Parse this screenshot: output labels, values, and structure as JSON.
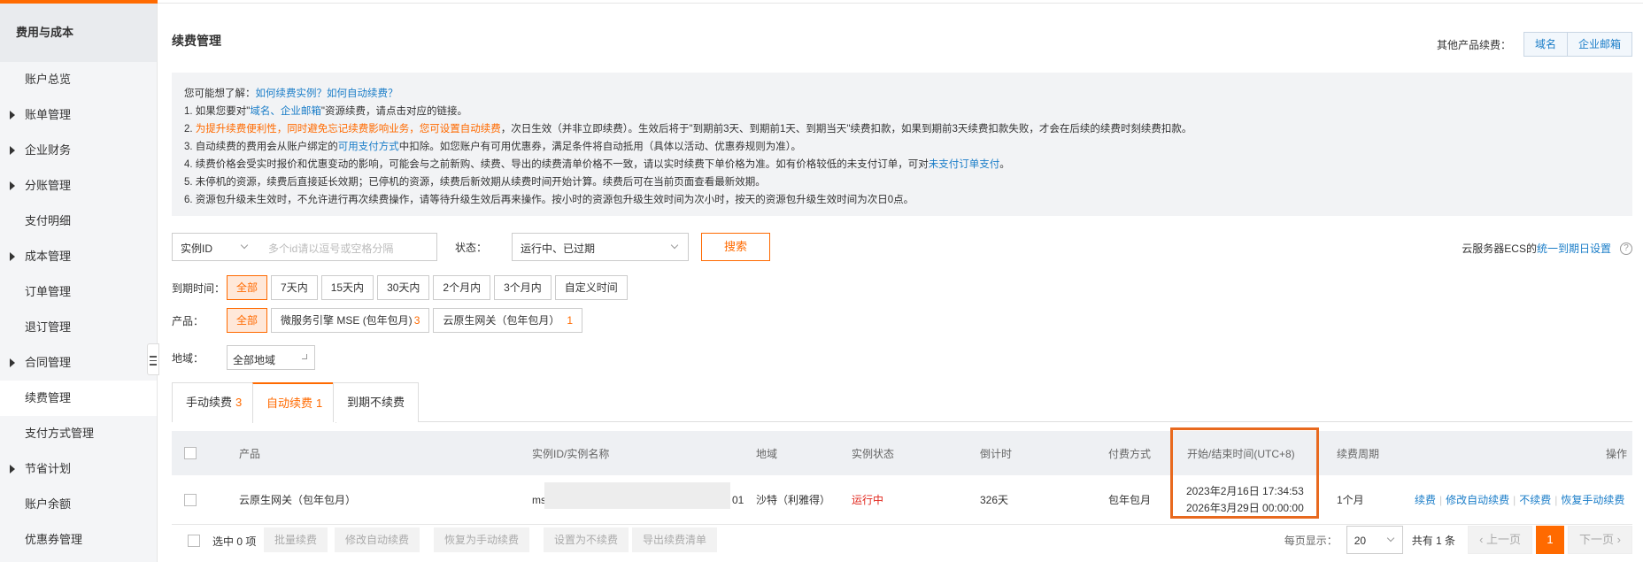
{
  "sidebar": {
    "header": "费用与成本",
    "items": [
      {
        "label": "账户总览",
        "expandable": false,
        "active": false
      },
      {
        "label": "账单管理",
        "expandable": true,
        "active": false
      },
      {
        "label": "企业财务",
        "expandable": true,
        "active": false
      },
      {
        "label": "分账管理",
        "expandable": true,
        "active": false
      },
      {
        "label": "支付明细",
        "expandable": false,
        "active": false
      },
      {
        "label": "成本管理",
        "expandable": true,
        "active": false
      },
      {
        "label": "订单管理",
        "expandable": false,
        "active": false
      },
      {
        "label": "退订管理",
        "expandable": false,
        "active": false
      },
      {
        "label": "合同管理",
        "expandable": true,
        "active": false
      },
      {
        "label": "续费管理",
        "expandable": false,
        "active": true
      },
      {
        "label": "支付方式管理",
        "expandable": false,
        "active": false
      },
      {
        "label": "节省计划",
        "expandable": true,
        "active": false
      },
      {
        "label": "账户余额",
        "expandable": false,
        "active": false
      },
      {
        "label": "优惠券管理",
        "expandable": false,
        "active": false
      }
    ]
  },
  "header": {
    "title": "续费管理",
    "other_label": "其他产品续费：",
    "other_buttons": [
      "域名",
      "企业邮箱"
    ]
  },
  "notice": {
    "intro": "您可能想了解：",
    "intro_links": "如何续费实例？如何自动续费？",
    "l1_a": "1. 如果您要对\"",
    "l1_link": "域名、企业邮箱",
    "l1_b": "\"资源续费，请点击对应的链接。",
    "l2_a": "2. ",
    "l2_warn": "为提升续费便利性，同时避免忘记续费影响业务，您可设置自动续费",
    "l2_b": "，次日生效（并非立即续费）。生效后将于\"到期前3天、到期前1天、到期当天\"续费扣款，如果到期前3天续费扣款失败，才会在后续的续费时刻续费扣款。",
    "l3_a": "3. 自动续费的费用会从账户绑定的",
    "l3_link": "可用支付方式",
    "l3_b": "中扣除。如您账户有可用优惠券，满足条件将自动抵用（具体以活动、优惠券规则为准）。",
    "l4_a": "4. 续费价格会受实时报价和优惠变动的影响，可能会与之前新购、续费、导出的续费清单价格不一致，请以实时续费下单价格为准。如有价格较低的未支付订单，可对",
    "l4_link": "未支付订单支付",
    "l4_b": "。",
    "l5": "5. 未停机的资源，续费后直接延长效期；已停机的资源，续费后新效期从续费时间开始计算。续费后可在当前页面查看最新效期。",
    "l6": "6. 资源包升级未生效时，不允许进行再次续费操作，请等待升级生效后再来操作。按小时的资源包升级生效时间为次小时，按天的资源包升级生效时间为次日0点。"
  },
  "filters": {
    "search_type": "实例ID",
    "search_placeholder": "多个id请以逗号或空格分隔",
    "status_label": "状态：",
    "status_value": "运行中、已过期",
    "search_button": "搜索",
    "ecs_text": "云服务器ECS的",
    "ecs_link": "统一到期日设置",
    "expire_label": "到期时间：",
    "expire_options": [
      "全部",
      "7天内",
      "15天内",
      "30天内",
      "2个月内",
      "3个月内",
      "自定义时间"
    ],
    "product_label": "产品：",
    "product_all": "全部",
    "product_options": [
      {
        "label": "微服务引擎 MSE (包年包月)",
        "count": "3"
      },
      {
        "label": "云原生网关（包年包月）",
        "count": "1"
      }
    ],
    "region_label": "地域：",
    "region_value": "全部地域"
  },
  "tabs": [
    {
      "label": "手动续费",
      "count": "3",
      "active": false
    },
    {
      "label": "自动续费",
      "count": "1",
      "active": true
    },
    {
      "label": "到期不续费",
      "count": "",
      "active": false
    }
  ],
  "table": {
    "columns": [
      "产品",
      "实例ID/实例名称",
      "地域",
      "实例状态",
      "倒计时",
      "付费方式",
      "开始/结束时间(UTC+8)",
      "续费周期",
      "操作"
    ],
    "rows": [
      {
        "product": "云原生网关（包年包月）",
        "instance_prefix": "ms",
        "instance_suffix": "01",
        "region": "沙特（利雅得）",
        "status": "运行中",
        "countdown": "326天",
        "pay_type": "包年包月",
        "start_time": "2023年2月16日 17:34:53",
        "end_time": "2026年3月29日 00:00:00",
        "period": "1个月",
        "ops": [
          "续费",
          "修改自动续费",
          "不续费",
          "恢复手动续费"
        ]
      }
    ]
  },
  "footer": {
    "selected": "选中 0 项",
    "batch_buttons": [
      "批量续费",
      "修改自动续费",
      "恢复为手动续费",
      "设置为不续费",
      "导出续费清单"
    ],
    "per_page_label": "每页显示：",
    "per_page": "20",
    "total": "共有 1 条",
    "prev": "上一页",
    "page": "1",
    "next": "下一页"
  },
  "colors": {
    "accent": "#ff6a00",
    "link": "#1a7dc8",
    "running": "#e1251b",
    "highlight_box": "#e8691e"
  }
}
